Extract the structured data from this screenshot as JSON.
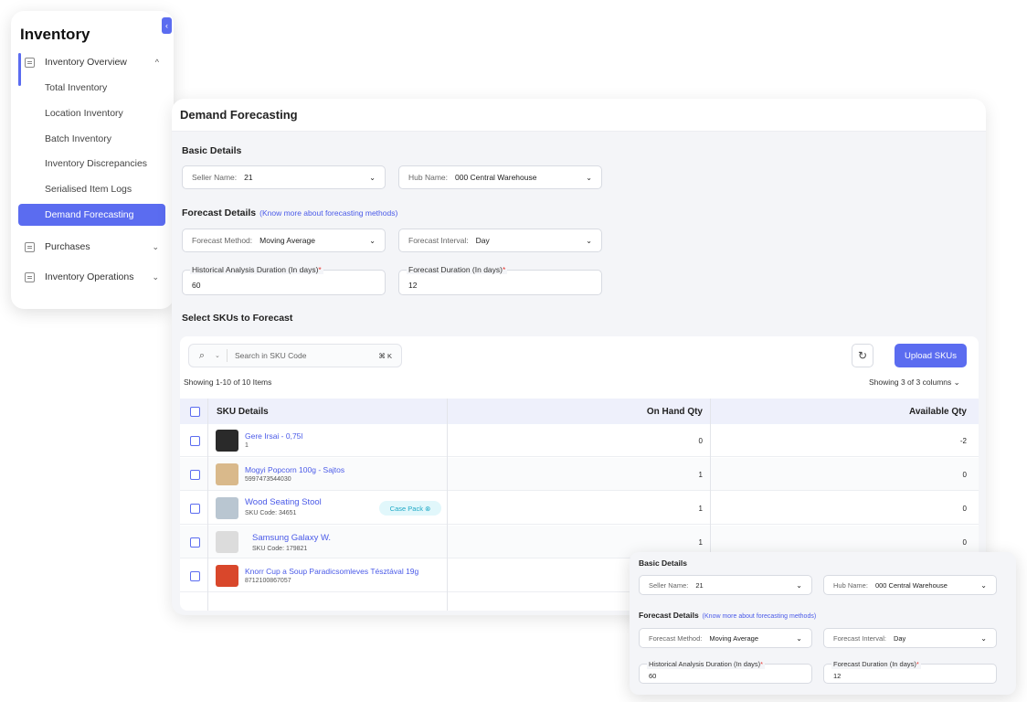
{
  "sidebar": {
    "title": "Inventory",
    "collapse_icon": "‹",
    "groups": [
      {
        "label": "Inventory Overview",
        "chevron": "^"
      },
      {
        "label": "Purchases",
        "chevron": "⌄"
      },
      {
        "label": "Inventory Operations",
        "chevron": "⌄"
      }
    ],
    "sub_items": [
      "Total Inventory",
      "Location Inventory",
      "Batch Inventory",
      "Inventory Discrepancies",
      "Serialised Item Logs",
      "Demand Forecasting"
    ]
  },
  "main": {
    "title": "Demand Forecasting",
    "basic_details": "Basic Details",
    "seller_label": "Seller Name:",
    "seller_value": "21",
    "hub_label": "Hub Name:",
    "hub_value": "000 Central Warehouse",
    "forecast_details": "Forecast Details",
    "forecast_link": "(Know more about forecasting methods)",
    "method_label": "Forecast Method:",
    "method_value": "Moving Average",
    "interval_label": "Forecast Interval:",
    "interval_value": "Day",
    "history_label": "Historical Analysis Duration (In days)",
    "history_value": "60",
    "duration_label": "Forecast Duration (In days)",
    "duration_value": "12",
    "required_mark": "*",
    "select_skus": "Select SKUs to Forecast",
    "search_placeholder": "Search in SKU Code",
    "search_kbd": "⌘ K",
    "upload_label": "Upload SKUs",
    "showing_items": "Showing 1-10 of 10 Items",
    "showing_columns": "Showing 3 of 3 columns",
    "columns": [
      "SKU Details",
      "On Hand Qty",
      "Available Qty"
    ],
    "rows": [
      {
        "name": "Gere Irsai - 0,75l",
        "code": "1",
        "on_hand": "0",
        "available": "-2",
        "badge": ""
      },
      {
        "name": "Mogyi Popcorn 100g - Sajtos",
        "code": "5997473544030",
        "on_hand": "1",
        "available": "0",
        "badge": ""
      },
      {
        "name": "Wood Seating Stool",
        "code": "SKU Code: 34651",
        "on_hand": "1",
        "available": "0",
        "badge": "Case Pack ⊗"
      },
      {
        "name": "Samsung Galaxy W.",
        "code": "SKU Code: 179821",
        "on_hand": "1",
        "available": "0",
        "badge": ""
      },
      {
        "name": "Knorr Cup a Soup Paradicsomleves Tésztával 19g",
        "code": "8712100867057",
        "on_hand": "",
        "available": "",
        "badge": ""
      }
    ]
  },
  "colors": {
    "accent": "#5b6cf0",
    "link": "#4a5ae8",
    "required": "#e53935",
    "badge_text": "#1fa9c6"
  }
}
